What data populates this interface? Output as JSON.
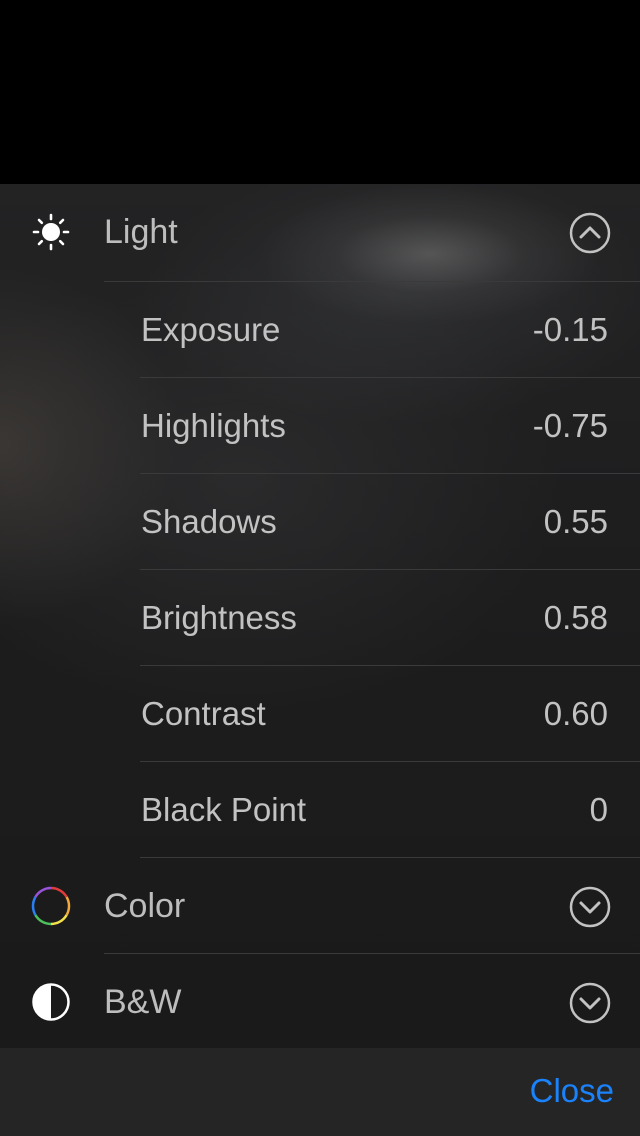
{
  "sections": {
    "light": {
      "label": "Light",
      "icon": "sun-icon",
      "expanded": true,
      "items": [
        {
          "label": "Exposure",
          "value": "-0.15"
        },
        {
          "label": "Highlights",
          "value": "-0.75"
        },
        {
          "label": "Shadows",
          "value": "0.55"
        },
        {
          "label": "Brightness",
          "value": "0.58"
        },
        {
          "label": "Contrast",
          "value": "0.60"
        },
        {
          "label": "Black Point",
          "value": "0"
        }
      ]
    },
    "color": {
      "label": "Color",
      "icon": "color-wheel-icon",
      "expanded": false
    },
    "bw": {
      "label": "B&W",
      "icon": "half-circle-icon",
      "expanded": false
    }
  },
  "footer": {
    "close_label": "Close"
  },
  "colors": {
    "accent": "#1a82fb",
    "text": "#bdbdbd",
    "panel": "#1c1c1c",
    "footer": "#252525"
  }
}
